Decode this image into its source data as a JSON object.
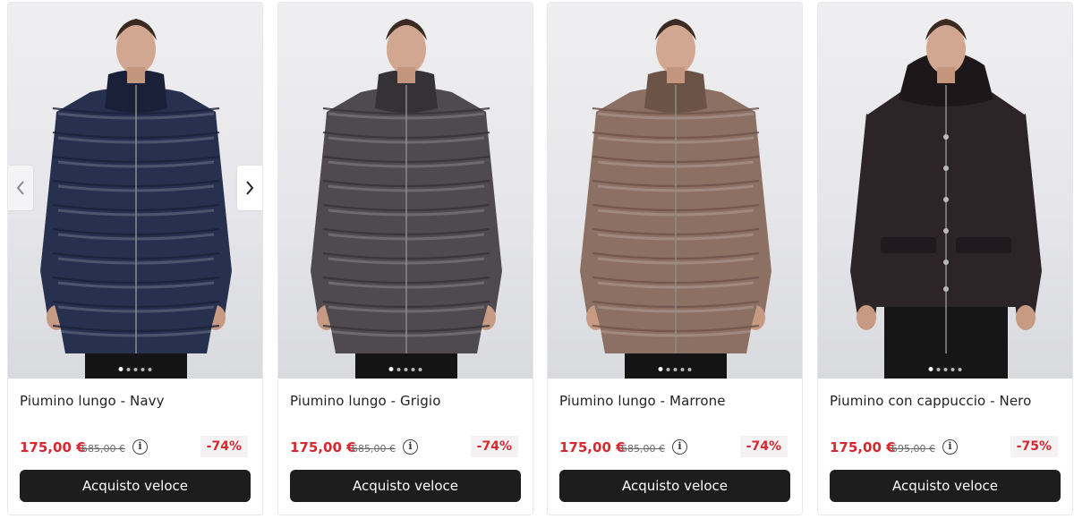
{
  "products": [
    {
      "title": "Piumino lungo - Navy",
      "price": "175,00 €",
      "old_price": "685,00 €",
      "discount": "-74%",
      "button_label": "Acquisto veloce",
      "jacket_color": "#27304f",
      "jacket_shade": "#1a2038",
      "style": "long-puffer",
      "carousel_dots": 5,
      "active_dot": 1
    },
    {
      "title": "Piumino lungo - Grigio",
      "price": "175,00 €",
      "old_price": "685,00 €",
      "discount": "-74%",
      "button_label": "Acquisto veloce",
      "jacket_color": "#4e4a4e",
      "jacket_shade": "#353236",
      "style": "long-puffer",
      "carousel_dots": 5,
      "active_dot": 1
    },
    {
      "title": "Piumino lungo - Marrone",
      "price": "175,00 €",
      "old_price": "685,00 €",
      "discount": "-74%",
      "button_label": "Acquisto veloce",
      "jacket_color": "#8c7063",
      "jacket_shade": "#6c5348",
      "style": "long-puffer",
      "carousel_dots": 5,
      "active_dot": 1
    },
    {
      "title": "Piumino con cappuccio - Nero",
      "price": "175,00 €",
      "old_price": "695,00 €",
      "discount": "-75%",
      "button_label": "Acquisto veloce",
      "jacket_color": "#2d2428",
      "jacket_shade": "#1d171a",
      "style": "hooded-parka",
      "carousel_dots": 5,
      "active_dot": 1
    }
  ],
  "carousel": {
    "prev_icon": "chevron-left-icon",
    "next_icon": "chevron-right-icon"
  },
  "icons": {
    "info": "i"
  },
  "colors": {
    "price_red": "#d7282f",
    "button_bg": "#1d1d1d"
  }
}
